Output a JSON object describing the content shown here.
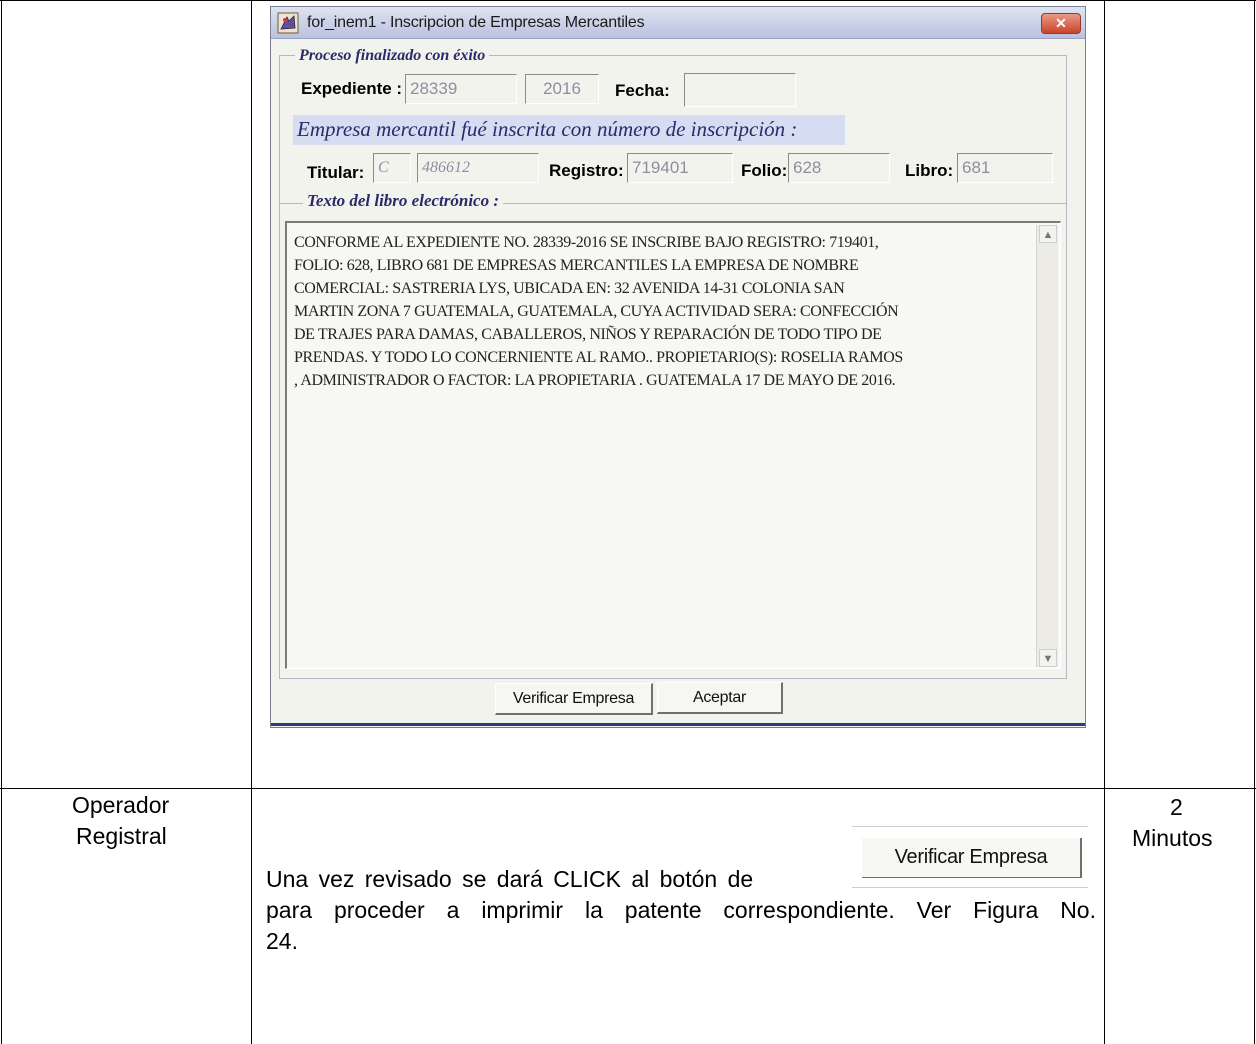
{
  "window": {
    "title": "for_inem1 - Inscripcion de Empresas Mercantiles",
    "close_glyph": "✕",
    "status_legend": "Proceso finalizado con éxito",
    "expediente_label": "Expediente :",
    "expediente_value": "28339",
    "expediente_year": "2016",
    "fecha_label": "Fecha:",
    "fecha_value": "",
    "banner": "Empresa mercantil fué inscrita con número de inscripción :",
    "titular_label": "Titular:",
    "titular_letter": "C",
    "titular_number": "486612",
    "registro_label": "Registro:",
    "registro_value": "719401",
    "folio_label": "Folio:",
    "folio_value": "628",
    "libro_label": "Libro:",
    "libro_value": "681",
    "text_legend": "Texto del libro electrónico :",
    "text_lines": [
      "CONFORME AL EXPEDIENTE NO. 28339-2016 SE INSCRIBE BAJO REGISTRO:  719401,",
      "FOLIO: 628, LIBRO 681 DE EMPRESAS MERCANTILES LA EMPRESA DE  NOMBRE",
      "COMERCIAL: SASTRERIA LYS, UBICADA EN: 32  AVENIDA  14-31  COLONIA  SAN",
      "MARTIN ZONA 7 GUATEMALA, GUATEMALA,  CUYA ACTIVIDAD SERA: CONFECCIÓN",
      "DE TRAJES PARA DAMAS, CABALLEROS, NIÑOS Y REPARACIÓN DE TODO TIPO DE",
      "PRENDAS. Y TODO LO CONCERNIENTE AL RAMO.. PROPIETARIO(S):  ROSELIA  RAMOS",
      ", ADMINISTRADOR O FACTOR:  LA PROPIETARIA . GUATEMALA 17 DE MAYO DE 2016."
    ],
    "verify_button": "Verificar Empresa",
    "accept_button": "Aceptar",
    "icons": {
      "app": "app-icon",
      "scroll_up": "scroll-up-arrow-icon",
      "scroll_down": "scroll-down-arrow-icon"
    }
  },
  "document": {
    "role_line1": "Operador",
    "role_line2": "Registral",
    "instruction_line1": "Una vez revisado se dará CLICK al botón de",
    "instruction_line2": "para proceder a imprimir la patente correspondiente. Ver Figura No.",
    "instruction_line3": "24.",
    "inline_button": "Verificar Empresa",
    "time_value": "2",
    "time_unit": "Minutos"
  },
  "colors": {
    "title_gradient_top": "#dfe4f2",
    "banner_bg": "#d6dcf2",
    "legend_text": "#2a2a6a",
    "close_button": "#c9452b"
  }
}
